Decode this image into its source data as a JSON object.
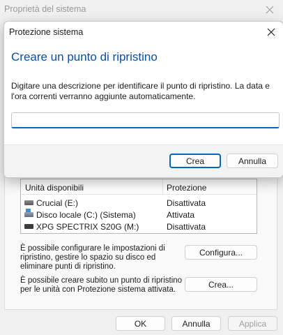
{
  "background_window": {
    "title": "Proprietà del sistema",
    "drive_table": {
      "headers": [
        "Unità disponibili",
        "Protezione"
      ],
      "rows": [
        {
          "name": "Crucial (E:)",
          "status": "Disattivata",
          "icon": "drive-icon"
        },
        {
          "name": "Disco locale (C:) (Sistema)",
          "status": "Attivata",
          "icon": "system-drive-icon"
        },
        {
          "name": "XPG SPECTRIX S20G (M:)",
          "status": "Disattivata",
          "icon": "ssd-drive-icon"
        }
      ]
    },
    "configure_text": "È possibile configurare le impostazioni di ripristino, gestire lo spazio su disco ed eliminare punti di ripristino.",
    "configure_button": "Configura...",
    "create_text": "È possibile creare subito un punto di ripristino per le unità con Protezione sistema attivata.",
    "create_button": "Crea...",
    "ok_button": "OK",
    "cancel_button": "Annulla",
    "apply_button": "Applica"
  },
  "dialog": {
    "title": "Protezione sistema",
    "heading": "Creare un punto di ripristino",
    "description": "Digitare una descrizione per identificare il punto di ripristino. La data e l'ora correnti verranno aggiunte automaticamente.",
    "input_value": "",
    "create_button": "Crea",
    "cancel_button": "Annulla"
  },
  "colors": {
    "heading": "#0b4ea2",
    "accent": "#0067c0"
  }
}
